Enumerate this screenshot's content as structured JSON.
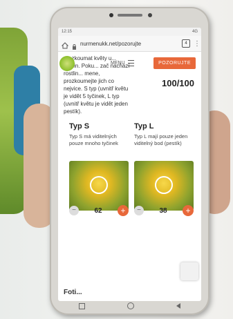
{
  "status_bar": {
    "time": "12:15",
    "right": "4G"
  },
  "browser": {
    "url": "nurmenukk.net/pozorujte",
    "tab_count": "4"
  },
  "site": {
    "intro_text": "prozkoumat květy u... rostlin. Poku... zač nachází rostlin... mene, prozkoumejte jich co nejvice. S typ (uvnitř květu je vidět 5 tyčinek, L typ (uvnitř květu je vidět jeden pestík).",
    "menu_label": "MENU",
    "cta_label": "POZORUJTE",
    "score": "100/100"
  },
  "types": [
    {
      "title": "Typ S",
      "description": "Typ S má viditelných pouze mnoho tyčinek",
      "count": "62"
    },
    {
      "title": "Typ L",
      "description": "Typ L mají pouze jeden viditelný bod (pestík)",
      "count": "38"
    }
  ],
  "next_heading": "Foti..."
}
